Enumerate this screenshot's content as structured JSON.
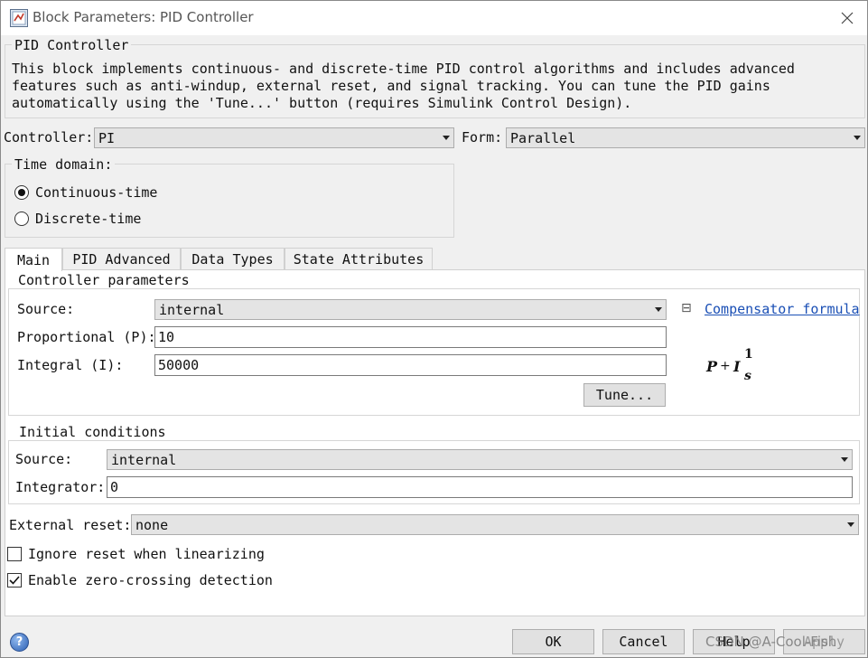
{
  "window": {
    "title": "Block Parameters: PID Controller",
    "close_icon": "close-icon"
  },
  "block": {
    "group_title": "PID Controller",
    "description": "This block implements continuous- and discrete-time PID control algorithms and includes advanced features such as anti-windup, external reset, and signal tracking. You can tune the PID gains automatically using the 'Tune...' button (requires Simulink Control Design)."
  },
  "controller": {
    "label": "Controller:",
    "value": "PI"
  },
  "form": {
    "label": "Form:",
    "value": "Parallel"
  },
  "time_domain": {
    "title": "Time domain:",
    "options": [
      {
        "label": "Continuous-time",
        "selected": true
      },
      {
        "label": "Discrete-time",
        "selected": false
      }
    ]
  },
  "tabs": [
    {
      "label": "Main",
      "active": true
    },
    {
      "label": "PID Advanced",
      "active": false
    },
    {
      "label": "Data Types",
      "active": false
    },
    {
      "label": "State Attributes",
      "active": false
    }
  ],
  "controller_params": {
    "title": "Controller parameters",
    "source_label": "Source:",
    "source_value": "internal",
    "p_label": "Proportional (P):",
    "p_value": "10",
    "i_label": "Integral (I):",
    "i_value": "50000",
    "tune_label": "Tune...",
    "formula_toggle": "⊟",
    "formula_link": "Compensator formula",
    "formula": {
      "p": "P",
      "plus": "+",
      "i": "I",
      "num": "1",
      "den": "s"
    }
  },
  "initial_conditions": {
    "title": "Initial conditions",
    "source_label": "Source:",
    "source_value": "internal",
    "integrator_label": "Integrator:",
    "integrator_value": "0"
  },
  "external_reset": {
    "label": "External reset:",
    "value": "none"
  },
  "checkboxes": [
    {
      "label": "Ignore reset when linearizing",
      "checked": false
    },
    {
      "label": "Enable zero-crossing detection",
      "checked": true
    }
  ],
  "footer": {
    "help_icon": "help-icon",
    "ok": "OK",
    "cancel": "Cancel",
    "help": "Help",
    "apply": "Apply",
    "watermark": "CSDN @A-Cool-Fish"
  }
}
